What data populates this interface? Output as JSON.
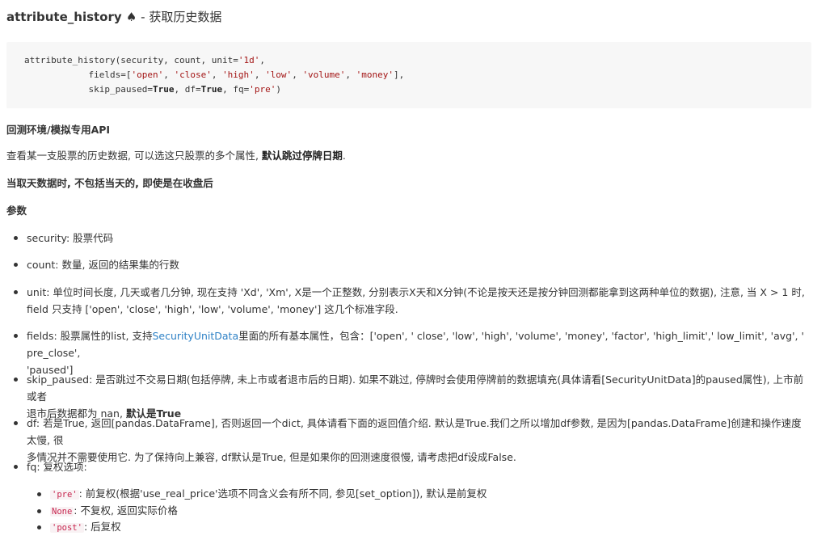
{
  "title": {
    "name": "attribute_history",
    "spade": "♠",
    "dash": " - ",
    "subtitle": "获取历史数据"
  },
  "code": {
    "line1_prefix": "attribute_history(security, count, unit=",
    "line1_str": "'1d'",
    "line1_suffix": ",",
    "line2_prefix": "            fields=[",
    "line2_s1": "'open'",
    "line2_s2": "'close'",
    "line2_s3": "'high'",
    "line2_s4": "'low'",
    "line2_s5": "'volume'",
    "line2_s6": "'money'",
    "line2_suffix": "],",
    "sep": ", ",
    "line3_a": "            skip_paused=",
    "line3_kw1": "True",
    "line3_b": ", df=",
    "line3_kw2": "True",
    "line3_c": ", fq=",
    "line3_str": "'pre'",
    "line3_d": ")"
  },
  "env_heading": "回测环境/模拟专用API",
  "desc": {
    "text": "查看某一支股票的历史数据, 可以选这只股票的多个属性, ",
    "bold": "默认跳过停牌日期",
    "end": "."
  },
  "note": "当取天数据时, 不包括当天的, 即使是在收盘后",
  "params_heading": "参数",
  "params": {
    "security": "security: 股票代码",
    "count": "count: 数量, 返回的结果集的行数",
    "unit_line1": "unit: 单位时间长度, 几天或者几分钟, 现在支持 'Xd', 'Xm', X是一个正整数, 分别表示X天和X分钟(不论是按天还是按分钟回测都能拿到这两种单位的数据), 注意, 当 X > 1 时,",
    "unit_line2": "field 只支持 ['open', 'close', 'high', 'low', 'volume', 'money'] 这几个标准字段.",
    "fields_a": "fields: 股票属性的list, 支持",
    "fields_link": "SecurityUnitData",
    "fields_b": "里面的所有基本属性，包含：['open', ' close', 'low', 'high', 'volume', 'money', 'factor', 'high_limit',' low_limit', 'avg', ' pre_close',",
    "fields_line2": "'paused']",
    "skip_line1": "skip_paused: 是否跳过不交易日期(包括停牌, 未上市或者退市后的日期). 如果不跳过, 停牌时会使用停牌前的数据填充(具体请看[SecurityUnitData]的paused属性), 上市前或者",
    "skip_line2_a": "退市后数据都为 nan, ",
    "skip_line2_bold": "默认是True",
    "df_line1": "df: 若是True, 返回[pandas.DataFrame], 否则返回一个dict, 具体请看下面的返回值介绍. 默认是True.我们之所以增加df参数, 是因为[pandas.DataFrame]创建和操作速度太慢, 很",
    "df_line2": "多情况并不需要使用它. 为了保持向上兼容, df默认是True, 但是如果你的回测速度很慢, 请考虑把df设成False.",
    "fq_label": "fq: 复权选项:"
  },
  "fq_options": [
    {
      "code": "'pre'",
      "text": ": 前复权(根据'use_real_price'选项不同含义会有所不同, 参见[set_option]), 默认是前复权"
    },
    {
      "code": "None",
      "text": ": 不复权, 返回实际价格"
    },
    {
      "code": "'post'",
      "text": ": 后复权"
    }
  ]
}
